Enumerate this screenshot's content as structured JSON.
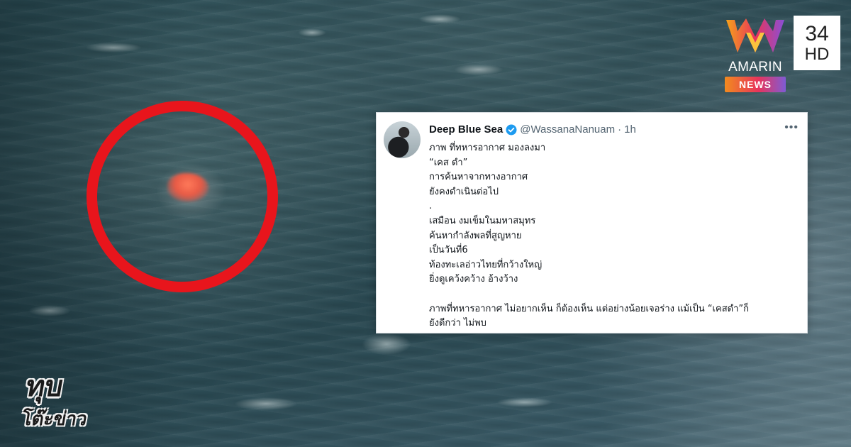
{
  "tweet": {
    "display_name": "Deep Blue Sea",
    "handle": "@WassanaNanuam",
    "separator": "·",
    "time": "1h",
    "more_label": "•••",
    "lines": [
      "ภาพ ที่ทหารอากาศ มองลงมา",
      "“เคส ดำ”",
      "การค้นหาจากทางอากาศ",
      "ยังคงดำเนินต่อไป",
      ".",
      "เสมือน งมเข็มในมหาสมุทร",
      "ค้นหากำลังพลที่สูญหาย",
      "เป็นวันที่6",
      "ท้องทะเลอ่าวไทยที่กว้างใหญ่",
      "ยิ่งดูเคว้งคว้าง อ้างว้าง",
      "",
      "ภาพที่ทหารอากาศ ไม่อยากเห็น ก็ต้องเห็น แต่อย่างน้อยเจอร่าง แม้เป็น “เคสดำ”ก็",
      "ยังดีกว่า ไม่พบ"
    ]
  },
  "channel_logo": {
    "brand": "AMARIN",
    "news_label": "NEWS",
    "channel_number": "34",
    "channel_suffix": "HD"
  },
  "program_logo": {
    "line1": "ทุบ",
    "line2": "โต๊ะข่าว"
  },
  "colors": {
    "highlight_circle": "#e8151c",
    "verified_badge": "#1d9bf0"
  }
}
